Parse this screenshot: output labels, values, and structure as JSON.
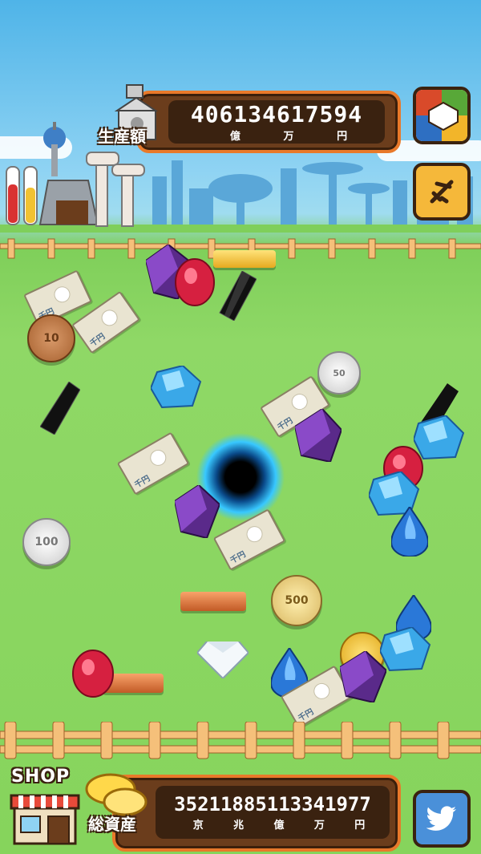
{
  "production": {
    "label": "生産額",
    "value": "406134617594",
    "units": [
      "億",
      "万",
      "円"
    ]
  },
  "assets": {
    "label": "総資産",
    "value": "35211885113341977",
    "units": [
      "京",
      "兆",
      "億",
      "万",
      "円"
    ]
  },
  "shop": {
    "label": "SHOP"
  },
  "coins": {
    "c10": "10",
    "c50": "50",
    "c100": "100",
    "c500": "500"
  },
  "banknote_label": "千円",
  "banknote_serial": "1000",
  "colors": {
    "panel": "#6b3d1c",
    "panel_border": "#e8792a",
    "twitter": "#4a90d9",
    "gold_button": "#f5b83a"
  }
}
